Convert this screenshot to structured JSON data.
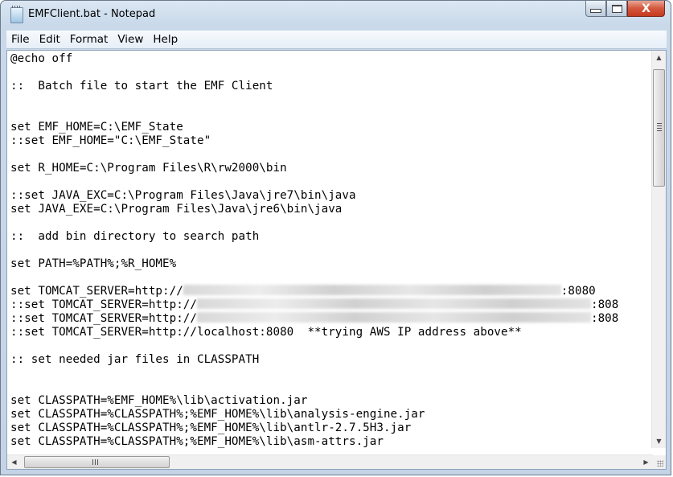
{
  "window": {
    "title": "EMFClient.bat - Notepad",
    "icon": "notepad-icon",
    "controls": {
      "minimize": "minimize-icon",
      "maximize": "maximize-icon",
      "close_glyph": "X"
    }
  },
  "menubar": {
    "items": [
      {
        "label": "File"
      },
      {
        "label": "Edit"
      },
      {
        "label": "Format"
      },
      {
        "label": "View"
      },
      {
        "label": "Help"
      }
    ]
  },
  "editor": {
    "lines": [
      {
        "text": "@echo off"
      },
      {
        "text": ""
      },
      {
        "text": "::  Batch file to start the EMF Client"
      },
      {
        "text": ""
      },
      {
        "text": ""
      },
      {
        "text": "set EMF_HOME=C:\\EMF_State"
      },
      {
        "text": "::set EMF_HOME=\"C:\\EMF_State\""
      },
      {
        "text": ""
      },
      {
        "text": "set R_HOME=C:\\Program Files\\R\\rw2000\\bin"
      },
      {
        "text": ""
      },
      {
        "text": "::set JAVA_EXC=C:\\Program Files\\Java\\jre7\\bin\\java"
      },
      {
        "text": "set JAVA_EXE=C:\\Program Files\\Java\\jre6\\bin\\java"
      },
      {
        "text": ""
      },
      {
        "text": "::  add bin directory to search path"
      },
      {
        "text": ""
      },
      {
        "text": "set PATH=%PATH%;%R_HOME%"
      },
      {
        "text": ""
      },
      {
        "text": "set TOMCAT_SERVER=http://",
        "redacted": true,
        "suffix": ":8080"
      },
      {
        "text": "::set TOMCAT_SERVER=http://",
        "redacted": true,
        "suffix": ":808"
      },
      {
        "text": "::set TOMCAT_SERVER=http://",
        "redacted": true,
        "suffix": ":808"
      },
      {
        "text": "::set TOMCAT_SERVER=http://localhost:8080  **trying AWS IP address above**"
      },
      {
        "text": ""
      },
      {
        "text": ":: set needed jar files in CLASSPATH"
      },
      {
        "text": ""
      },
      {
        "text": ""
      },
      {
        "text": "set CLASSPATH=%EMF_HOME%\\lib\\activation.jar"
      },
      {
        "text": "set CLASSPATH=%CLASSPATH%;%EMF_HOME%\\lib\\analysis-engine.jar"
      },
      {
        "text": "set CLASSPATH=%CLASSPATH%;%EMF_HOME%\\lib\\antlr-2.7.5H3.jar"
      },
      {
        "text": "set CLASSPATH=%CLASSPATH%;%EMF_HOME%\\lib\\asm-attrs.jar"
      }
    ]
  },
  "scrollbars": {
    "vertical_position": 0.0,
    "horizontal_position": 0.0
  }
}
